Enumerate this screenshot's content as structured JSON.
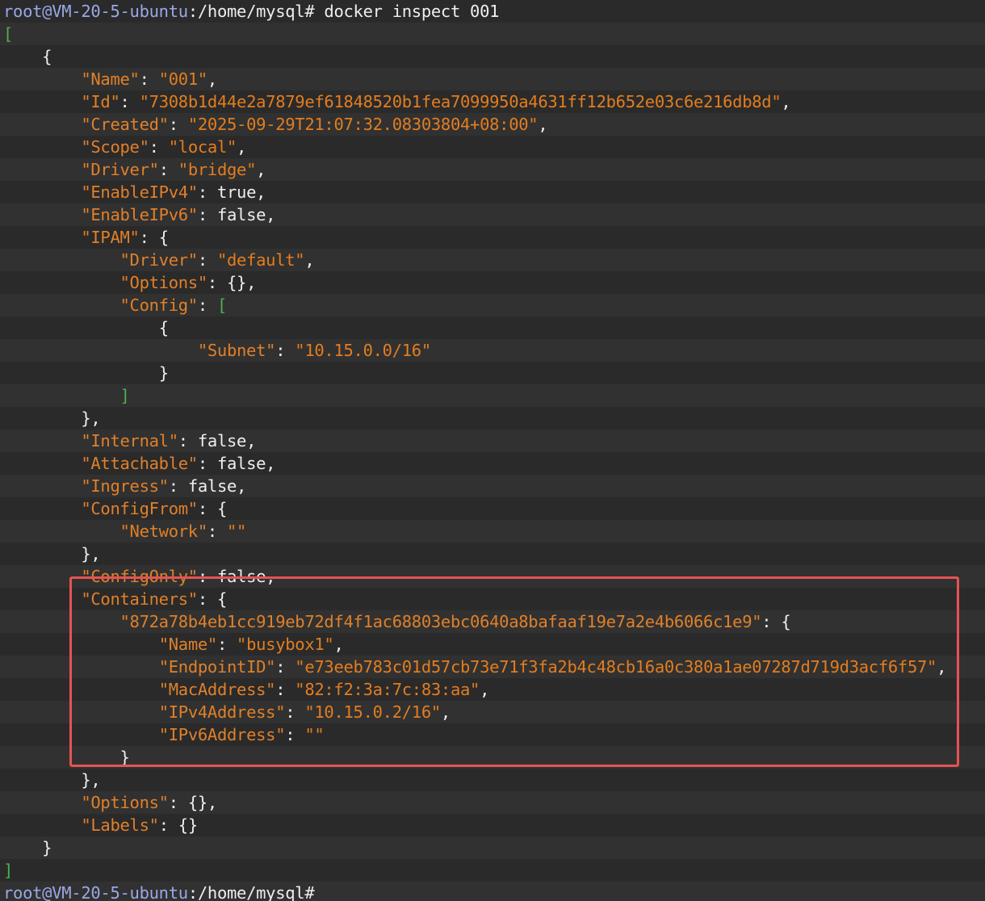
{
  "prompt": {
    "user_host": "root@VM-20-5-ubuntu",
    "path": ":/home/mysql",
    "symbol": "# ",
    "command": "docker inspect 001"
  },
  "json_output": {
    "name_key": "\"Name\"",
    "name_val": "\"001\"",
    "id_key": "\"Id\"",
    "id_val": "\"7308b1d44e2a7879ef61848520b1fea7099950a4631ff12b652e03c6e216db8d\"",
    "created_key": "\"Created\"",
    "created_val": "\"2025-09-29T21:07:32.08303804+08:00\"",
    "scope_key": "\"Scope\"",
    "scope_val": "\"local\"",
    "driver_key": "\"Driver\"",
    "driver_val": "\"bridge\"",
    "ipv4_key": "\"EnableIPv4\"",
    "ipv4_val": "true",
    "ipv6_key": "\"EnableIPv6\"",
    "ipv6_val": "false",
    "ipam_key": "\"IPAM\"",
    "ipam_driver_key": "\"Driver\"",
    "ipam_driver_val": "\"default\"",
    "ipam_options_key": "\"Options\"",
    "ipam_options_val": "{}",
    "ipam_config_key": "\"Config\"",
    "subnet_key": "\"Subnet\"",
    "subnet_val": "\"10.15.0.0/16\"",
    "internal_key": "\"Internal\"",
    "internal_val": "false",
    "attachable_key": "\"Attachable\"",
    "attachable_val": "false",
    "ingress_key": "\"Ingress\"",
    "ingress_val": "false",
    "configfrom_key": "\"ConfigFrom\"",
    "network_key": "\"Network\"",
    "network_val": "\"\"",
    "configonly_key": "\"ConfigOnly\"",
    "configonly_val": "false",
    "containers_key": "\"Containers\"",
    "container_id": "\"872a78b4eb1cc919eb72df4f1ac68803ebc0640a8bafaaf19e7a2e4b6066c1e9\"",
    "c_name_key": "\"Name\"",
    "c_name_val": "\"busybox1\"",
    "c_endpoint_key": "\"EndpointID\"",
    "c_endpoint_val": "\"e73eeb783c01d57cb73e71f3fa2b4c48cb16a0c380a1ae07287d719d3acf6f57\"",
    "c_mac_key": "\"MacAddress\"",
    "c_mac_val": "\"82:f2:3a:7c:83:aa\"",
    "c_ipv4_key": "\"IPv4Address\"",
    "c_ipv4_val": "\"10.15.0.2/16\"",
    "c_ipv6_key": "\"IPv6Address\"",
    "c_ipv6_val": "\"\"",
    "options_key": "\"Options\"",
    "options_val": "{}",
    "labels_key": "\"Labels\"",
    "labels_val": "{}"
  },
  "colors": {
    "background": "#2b2b2b",
    "key": "#e0802a",
    "string": "#e37d1f",
    "bracket": "#4caf50",
    "prompt_user": "#9aa7e6",
    "highlight_border": "#e55353"
  }
}
